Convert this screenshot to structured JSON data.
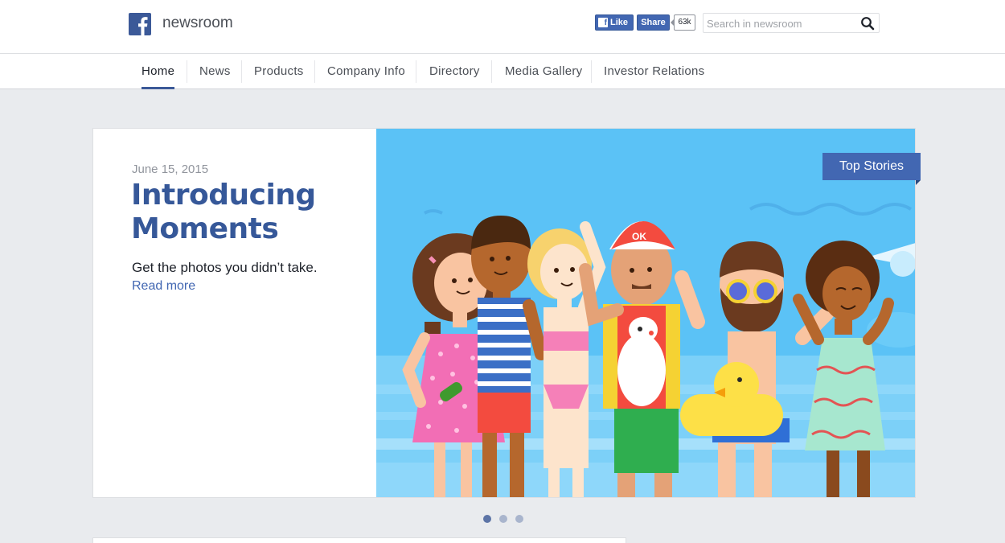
{
  "header": {
    "brand": "newsroom",
    "like_label": "Like",
    "share_label": "Share",
    "like_count": "63k",
    "search_placeholder": "Search in newsroom",
    "search_value": ""
  },
  "nav": {
    "items": [
      {
        "label": "Home",
        "active": true
      },
      {
        "label": "News"
      },
      {
        "label": "Products"
      },
      {
        "label": "Company Info"
      },
      {
        "label": "Directory"
      },
      {
        "label": "Media Gallery"
      },
      {
        "label": "Investor Relations"
      }
    ]
  },
  "hero": {
    "date": "June 15, 2015",
    "title": "Introducing Moments",
    "summary": "Get the photos you didn’t take.",
    "read_more": "Read more",
    "badge": "Top Stories",
    "slide_count": 3,
    "active_slide": 1
  },
  "colors": {
    "brand_blue": "#3b5998",
    "link_blue": "#4267b2",
    "sky": "#5bc2f6",
    "page_bg": "#e9ebee"
  },
  "icons": [
    "facebook-logo-icon",
    "search-icon"
  ]
}
